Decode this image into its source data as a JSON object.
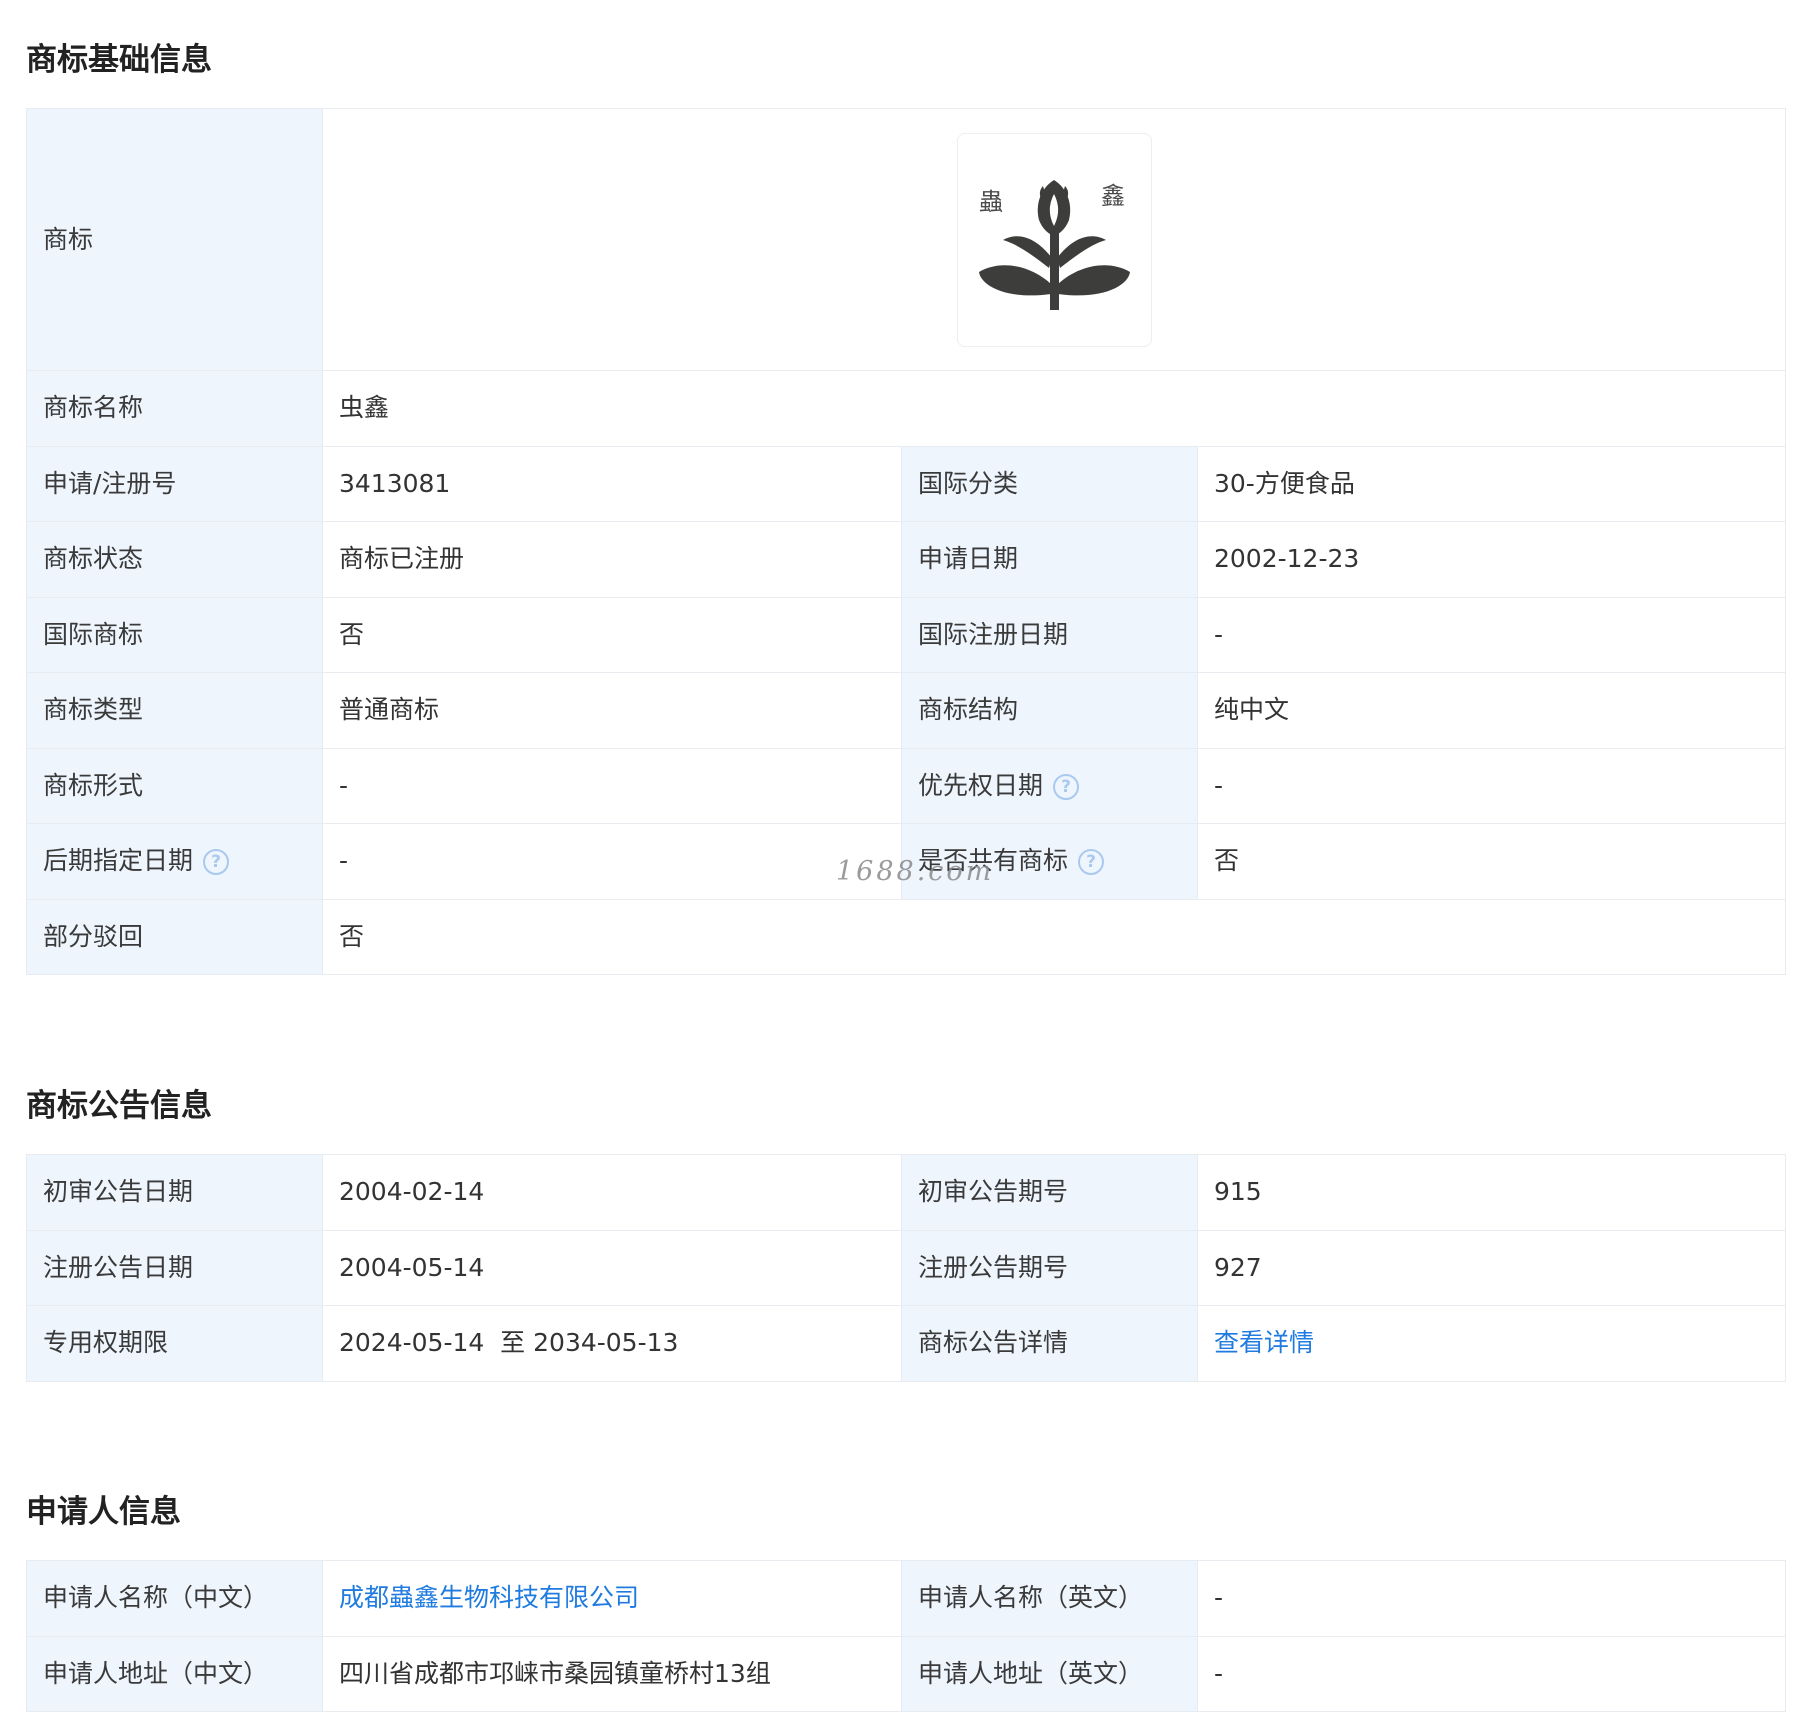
{
  "sections": {
    "basic_title": "商标基础信息",
    "notice_title": "商标公告信息",
    "applicant_title": "申请人信息"
  },
  "basic": {
    "trademark_label": "商标",
    "logo_chars": [
      "蟲",
      "鑫"
    ],
    "name_label": "商标名称",
    "name_value": "虫鑫",
    "regno_label": "申请/注册号",
    "regno_value": "3413081",
    "intl_class_label": "国际分类",
    "intl_class_value": "30-方便食品",
    "status_label": "商标状态",
    "status_value": "商标已注册",
    "apply_date_label": "申请日期",
    "apply_date_value": "2002-12-23",
    "intl_tm_label": "国际商标",
    "intl_tm_value": "否",
    "intl_reg_date_label": "国际注册日期",
    "intl_reg_date_value": "-",
    "type_label": "商标类型",
    "type_value": "普通商标",
    "structure_label": "商标结构",
    "structure_value": "纯中文",
    "form_label": "商标形式",
    "form_value": "-",
    "priority_label": "优先权日期",
    "priority_value": "-",
    "later_date_label": "后期指定日期",
    "later_date_value": "-",
    "shared_label": "是否共有商标",
    "shared_value": "否",
    "partial_reject_label": "部分驳回",
    "partial_reject_value": "否",
    "help_glyph": "?"
  },
  "watermark": "1688.com",
  "notice": {
    "prelim_date_label": "初审公告日期",
    "prelim_date_value": "2004-02-14",
    "prelim_no_label": "初审公告期号",
    "prelim_no_value": "915",
    "reg_date_label": "注册公告日期",
    "reg_date_value": "2004-05-14",
    "reg_no_label": "注册公告期号",
    "reg_no_value": "927",
    "term_label": "专用权期限",
    "term_value": "2024-05-14  至 2034-05-13",
    "detail_label": "商标公告详情",
    "detail_link": "查看详情"
  },
  "applicant": {
    "name_cn_label": "申请人名称（中文）",
    "name_cn_value": "成都蟲鑫生物科技有限公司",
    "name_en_label": "申请人名称（英文）",
    "name_en_value": "-",
    "addr_cn_label": "申请人地址（中文）",
    "addr_cn_value": "四川省成都市邛崃市桑园镇童桥村13组",
    "addr_en_label": "申请人地址（英文）",
    "addr_en_value": "-"
  },
  "colors": {
    "label_bg": "#eef5fd",
    "border": "#e8ecf1",
    "link": "#1f7be0",
    "logo": "#3d3d3b"
  }
}
